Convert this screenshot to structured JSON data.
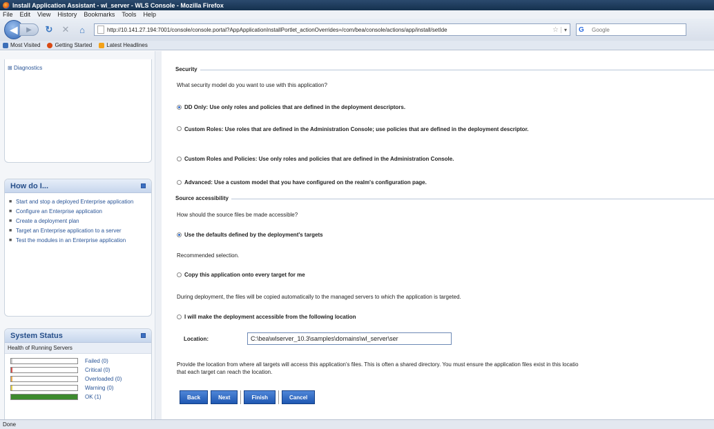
{
  "window": {
    "title": "Install Application Assistant - wl_server - WLS Console - Mozilla Firefox"
  },
  "menu": [
    "File",
    "Edit",
    "View",
    "History",
    "Bookmarks",
    "Tools",
    "Help"
  ],
  "nav": {
    "url": "http://10.141.27.194:7001/console/console.portal?AppApplicationInstallPortlet_actionOverrides=/com/bea/console/actions/app/install/setIde",
    "search_placeholder": "Google"
  },
  "bookmarks": [
    "Most Visited",
    "Getting Started",
    "Latest Headlines"
  ],
  "sidebar": {
    "tree_item": "Diagnostics",
    "howdo": {
      "title": "How do I...",
      "items": [
        "Start and stop a deployed Enterprise application",
        "Configure an Enterprise application",
        "Create a deployment plan",
        "Target an Enterprise application to a server",
        "Test the modules in an Enterprise application"
      ]
    },
    "status": {
      "title": "System Status",
      "subtitle": "Health of Running Servers",
      "rows": [
        {
          "label": "Failed (0)",
          "color": "#cccccc"
        },
        {
          "label": "Critical (0)",
          "color": "#d9534f"
        },
        {
          "label": "Overloaded (0)",
          "color": "#f0ad4e"
        },
        {
          "label": "Warning (0)",
          "color": "#e6d34a"
        },
        {
          "label": "OK (1)",
          "color": "#3d8a2e"
        }
      ]
    }
  },
  "main": {
    "security": {
      "legend": "Security",
      "question": "What security model do you want to use with this application?",
      "options": [
        "DD Only: Use only roles and policies that are defined in the deployment descriptors.",
        "Custom Roles: Use roles that are defined in the Administration Console; use policies that are defined in the deployment descriptor.",
        "Custom Roles and Policies: Use only roles and policies that are defined in the Administration Console.",
        "Advanced: Use a custom model that you have configured on the realm's configuration page."
      ]
    },
    "source": {
      "legend": "Source accessibility",
      "question": "How should the source files be made accessible?",
      "option1": "Use the defaults defined by the deployment's targets",
      "note1": "Recommended selection.",
      "option2": "Copy this application onto every target for me",
      "note2": "During deployment, the files will be copied automatically to the managed servers to which the application is targeted.",
      "option3": "I will make the deployment accessible from the following location",
      "location_label": "Location:",
      "location_value": "C:\\bea\\wlserver_10.3\\samples\\domains\\wl_server\\ser",
      "help_line1": "Provide the location from where all targets will access this application's files. This is often a shared directory. You must ensure the application files exist in this locatio",
      "help_line2": "that each target can reach the location."
    },
    "buttons": {
      "back": "Back",
      "next": "Next",
      "finish": "Finish",
      "cancel": "Cancel"
    }
  },
  "statusbar": {
    "text": "Done"
  }
}
